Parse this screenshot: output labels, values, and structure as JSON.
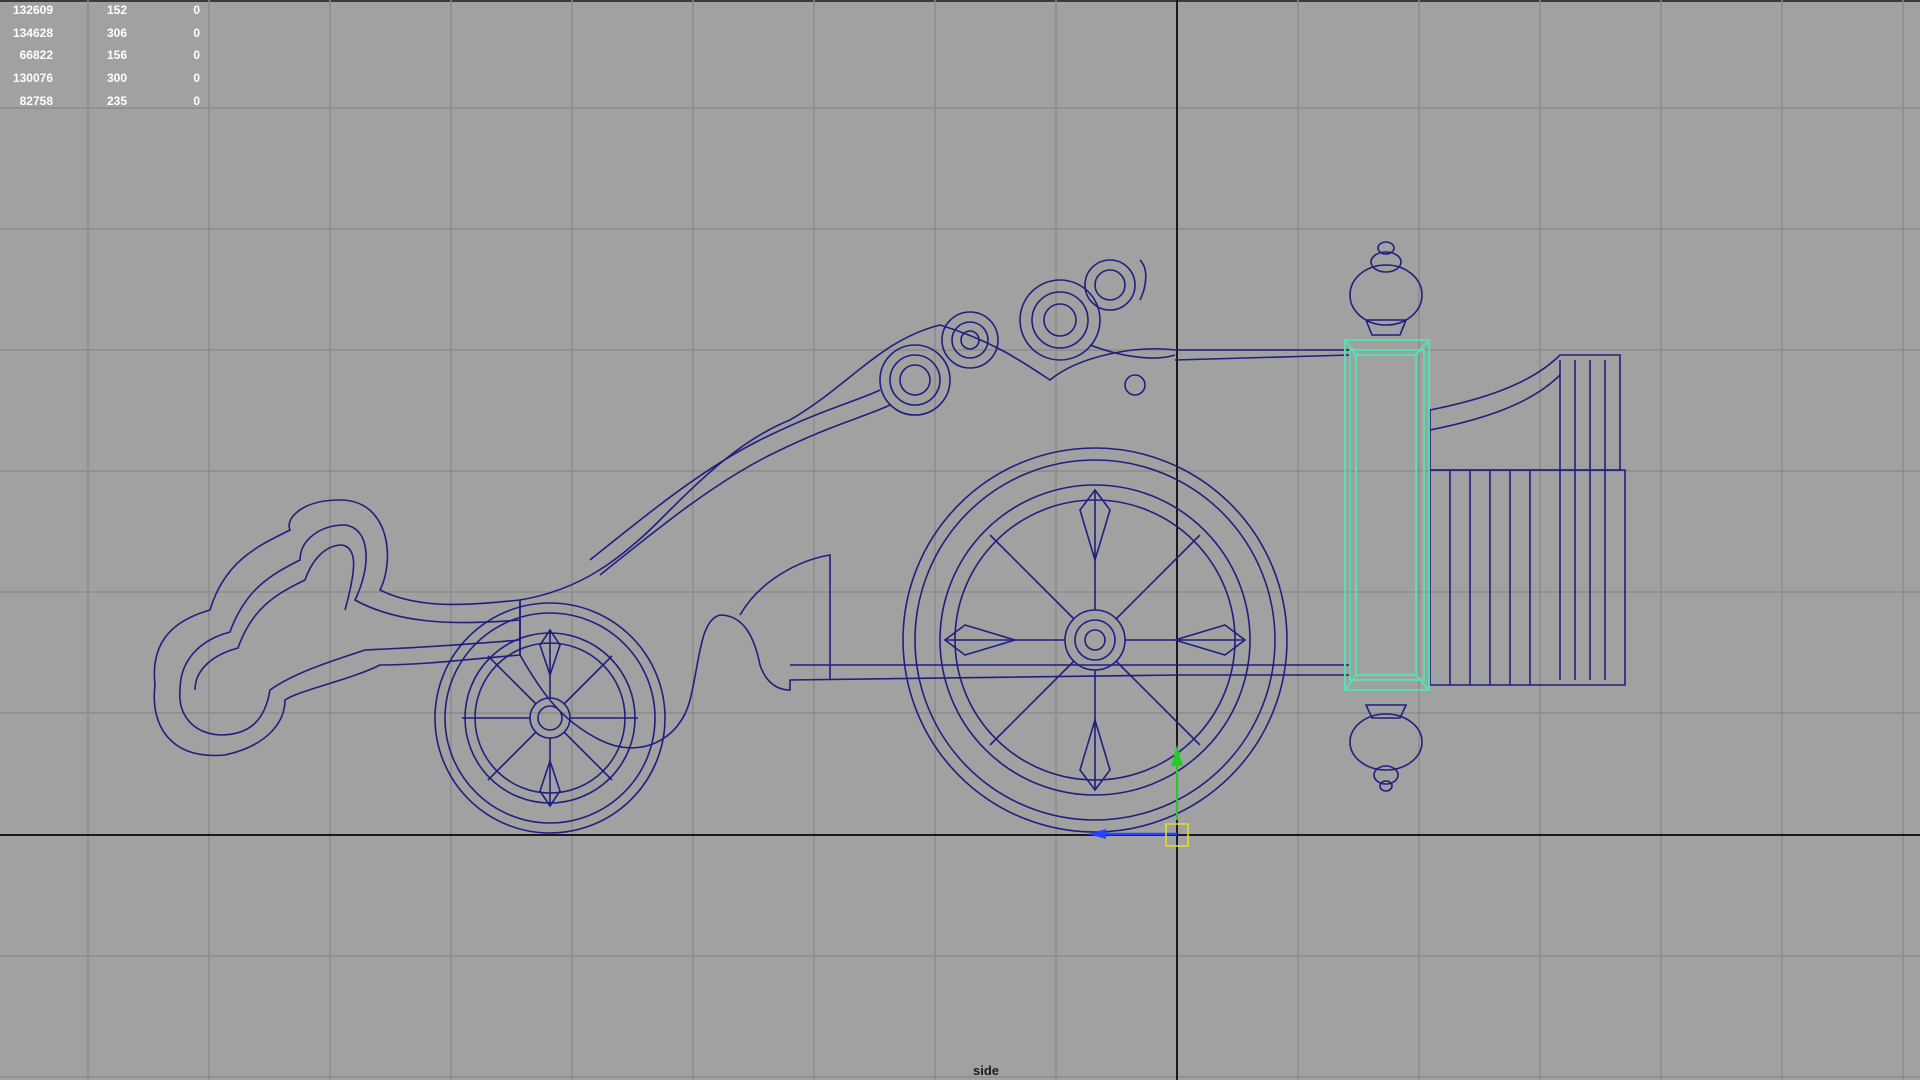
{
  "viewport": {
    "camera_label": "side",
    "background_color": "#a1a1a1",
    "grid_color": "#8c8c8c",
    "axis_color": "#1a1a1a",
    "wire_color": "#1f1f80",
    "selected_wire_color": "#4fe8b0",
    "manipulator_y_color": "#22cc22",
    "manipulator_z_color": "#2244ff",
    "pivot_color": "#e8e020"
  },
  "hud_stats": {
    "rows": [
      [
        "132609",
        "152",
        "0"
      ],
      [
        "134628",
        "306",
        "0"
      ],
      [
        "66822",
        "156",
        "0"
      ],
      [
        "130076",
        "300",
        "0"
      ],
      [
        "82758",
        "235",
        "0"
      ]
    ]
  },
  "scene": {
    "object_name": "cannon-wireframe",
    "selected_object": "vertical-post",
    "icons": [
      "move-manipulator-icon",
      "pivot-handle-icon"
    ]
  }
}
